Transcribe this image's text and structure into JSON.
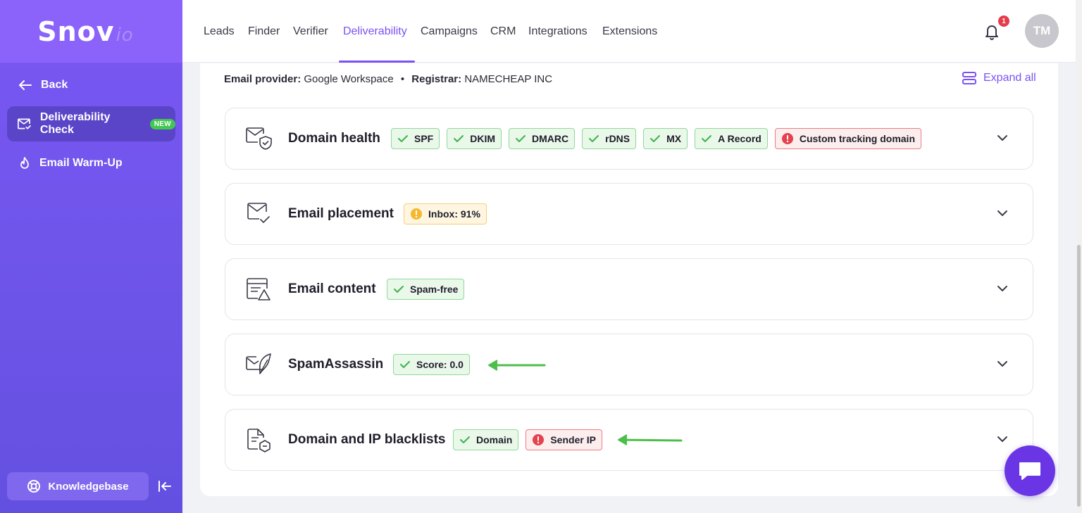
{
  "app": {
    "logo_main": "Snov",
    "logo_suffix": "io"
  },
  "sidebar": {
    "back_label": "Back",
    "items": [
      {
        "label": "Deliverability Check",
        "badge": "NEW"
      },
      {
        "label": "Email Warm-Up"
      }
    ],
    "knowledgebase_label": "Knowledgebase"
  },
  "topnav": {
    "items": [
      "Leads",
      "Finder",
      "Verifier",
      "Deliverability",
      "Campaigns",
      "CRM",
      "Integrations",
      "Extensions"
    ],
    "active": "Deliverability",
    "notification_count": "1",
    "avatar_initials": "TM"
  },
  "provider": {
    "email_provider_label": "Email provider:",
    "email_provider_value": "Google Workspace",
    "separator": "•",
    "registrar_label": "Registrar:",
    "registrar_value": "NAMECHEAP INC"
  },
  "expand_all_label": "Expand all",
  "sections": [
    {
      "title": "Domain health",
      "icon": "mail-shield-icon",
      "chips": [
        {
          "label": "SPF",
          "status": "ok"
        },
        {
          "label": "DKIM",
          "status": "ok"
        },
        {
          "label": "DMARC",
          "status": "ok"
        },
        {
          "label": "rDNS",
          "status": "ok"
        },
        {
          "label": "MX",
          "status": "ok"
        },
        {
          "label": "A Record",
          "status": "ok"
        },
        {
          "label": "Custom tracking domain",
          "status": "error"
        }
      ]
    },
    {
      "title": "Email placement",
      "icon": "mail-check-icon",
      "chips": [
        {
          "label": "Inbox: 91%",
          "status": "warning"
        }
      ]
    },
    {
      "title": "Email content",
      "icon": "document-warning-icon",
      "chips": [
        {
          "label": "Spam-free",
          "status": "ok"
        }
      ]
    },
    {
      "title": "SpamAssassin",
      "icon": "mail-feather-icon",
      "chips": [
        {
          "label": "Score: 0.0",
          "status": "ok"
        }
      ]
    },
    {
      "title": "Domain and IP blacklists",
      "icon": "document-block-icon",
      "chips": [
        {
          "label": "Domain",
          "status": "ok"
        },
        {
          "label": "Sender IP",
          "status": "error"
        }
      ]
    }
  ],
  "colors": {
    "accent": "#7a52f4",
    "sidebar": "#6f55ea",
    "ok_border": "#8ed99a",
    "error_border": "#ee7c84",
    "warning_border": "#f5cf75",
    "annotation_arrow": "#4cbf4a"
  }
}
